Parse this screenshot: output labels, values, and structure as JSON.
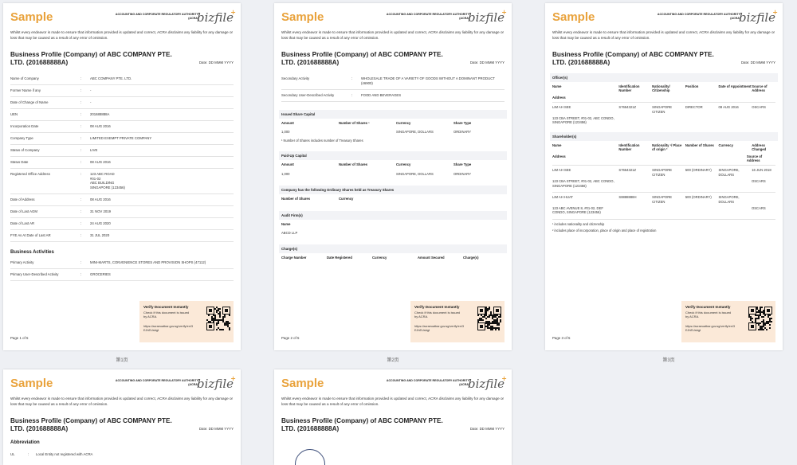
{
  "header": {
    "sample": "Sample",
    "authority_line1": "ACCOUNTING AND CORPORATE REGULATORY AUTHORITY",
    "authority_line2": "(ACRA)",
    "logo": "bizfile",
    "logo_plus": "+"
  },
  "disclaimer": "Whilst every endeavor is made to ensure that information provided is updated and correct, ACRA disclaims any liability for any damage or loss that may be caused as a result of any error of omission.",
  "doc_title": "Business Profile (Company) of ABC COMPANY PTE. LTD. (201688888A)",
  "date_label": "Date: DD MMM YYYY",
  "verify": {
    "title": "Verify Document Instantly",
    "body": "Check if this document is issued by ACRA.",
    "url": "https://acraeuatbar.gov.sg/verify/en/3EJhEUsbgt"
  },
  "captions": [
    "第1页",
    "第2页",
    "第3页"
  ],
  "page1": {
    "rows": [
      {
        "k": "Name of Company",
        "v": "ABC COMPANY PTE. LTD."
      },
      {
        "k": "Former Name if any",
        "v": "-"
      },
      {
        "k": "Date of Change of Name",
        "v": "-"
      },
      {
        "k": "UEN",
        "v": "201688888A"
      },
      {
        "k": "Incorporation Date",
        "v": "08 AUG 2016"
      },
      {
        "k": "Company Type",
        "v": "LIMITED EXEMPT PRIVATE COMPANY"
      },
      {
        "k": "Status of Company",
        "v": "LIVE"
      },
      {
        "k": "Status Date",
        "v": "08 AUG 2016"
      },
      {
        "k": "Registered Office Address",
        "v": "123 ABC ROAD\n#01-02\nABC BUILDING\nSINGAPORE (123456)"
      },
      {
        "k": "Date of Address",
        "v": "08 AUG 2016"
      },
      {
        "k": "Date of Last AGM",
        "v": "31 NOV 2019"
      },
      {
        "k": "Date of Last AR",
        "v": "24 AUG 2020"
      },
      {
        "k": "FYE As At Date of Last AR",
        "v": "31 JUL 2020"
      }
    ],
    "activities_title": "Business Activities",
    "activities": [
      {
        "k": "Primary Activity",
        "v": "MINI-MARTS, CONVENIENCE STORES AND PROVISION SHOPS (47112)"
      },
      {
        "k": "Primary User-Described Activity",
        "v": "GROCERIES"
      }
    ],
    "page_num": "Page 1 of 5"
  },
  "page2": {
    "rows": [
      {
        "k": "Secondary Activity",
        "v": "WHOLESALE TRADE OF A VARIETY OF GOODS WITHOUT A DOMINANT PRODUCT (46900)"
      },
      {
        "k": "Secondary User-Described Activity",
        "v": "FOOD AND BEVERAGES"
      }
    ],
    "issued_title": "Issued Share Capital",
    "share_headers": [
      "Amount",
      "Number of Shares ¹",
      "Currency",
      "Share Type"
    ],
    "issued_row": [
      "1,000",
      "",
      "SINGAPORE, DOLLARS",
      "ORDINARY"
    ],
    "issued_note": "¹ Number of Shares includes number of Treasury Shares",
    "paid_title": "Paid-Up Capital",
    "paid_headers": [
      "Amount",
      "Number of Shares",
      "Currency",
      "Share Type"
    ],
    "paid_row": [
      "1,000",
      "",
      "SINGAPORE, DOLLARS",
      "ORDINARY"
    ],
    "treasury_title": "Company has the following Ordinary Shares held as Treasury Shares",
    "treasury_headers": [
      "Number of Shares",
      "Currency"
    ],
    "audit_title": "Audit Firm(s)",
    "audit_header": "Name",
    "audit_value": "ABCD LLP",
    "charge_title": "Charge(s)",
    "charge_headers": [
      "Charge Number",
      "Date Registered",
      "Currency",
      "Amount Secured",
      "Charge(s)"
    ],
    "page_num": "Page 2 of 5"
  },
  "page3": {
    "officer_title": "Officer(s)",
    "officer_headers": [
      "Name",
      "Identification Number",
      "Nationality/ Citizenship",
      "Position",
      "Date of Appointment",
      "Source of Address"
    ],
    "officer_header_address": "Address",
    "officer": {
      "name": "LIM AH SEE",
      "id": "S7654321Z",
      "nat": "SINGAPORE CITIZEN",
      "pos": "DIRECTOR",
      "date": "08 AUG 2016",
      "src": "OSCARS",
      "addr": "123 CBA STREET, #01-02, ABC CONDO, SINGAPORE (123456)"
    },
    "holder_title": "Shareholder(s)",
    "holder_headers": [
      "Name",
      "Identification Number",
      "Nationality ¹/ Place of origin ²",
      "Number of Shares",
      "Currency",
      "Address Changed"
    ],
    "holder_header_address": "Address",
    "holder_header_src": "Source of Address",
    "holders": [
      {
        "name": "LIM AH SEE",
        "id": "S7654321Z",
        "nat": "SINGAPORE CITIZEN",
        "shares": "500 (ORDINARY)",
        "cur": "SINGAPORE, DOLLARS",
        "chg": "16 JUN 2018",
        "src": "OSCARS",
        "addr": "123 CBA STREET, #01-02, ABC CONDO, SINGAPORE (123456)"
      },
      {
        "name": "LIM AH HUAT",
        "id": "S8888888H",
        "nat": "SINGAPORE CITIZEN",
        "shares": "500 (ORDINARY)",
        "cur": "SINGAPORE, DOLLARS",
        "chg": "",
        "src": "OSCARS",
        "addr": "123 ABC AVENUE 8, #01-02, DEF CONDO, SINGAPORE (123456)"
      }
    ],
    "note1": "¹ includes nationality and citizenship",
    "note2": "² includes place of incorporation, place of origin and place of registration",
    "page_num": "Page 3 of 5"
  },
  "page4": {
    "abbr_title": "Abbreviation",
    "abbr_k": "UL",
    "abbr_v": "Local Entity not registered with ACRA"
  }
}
